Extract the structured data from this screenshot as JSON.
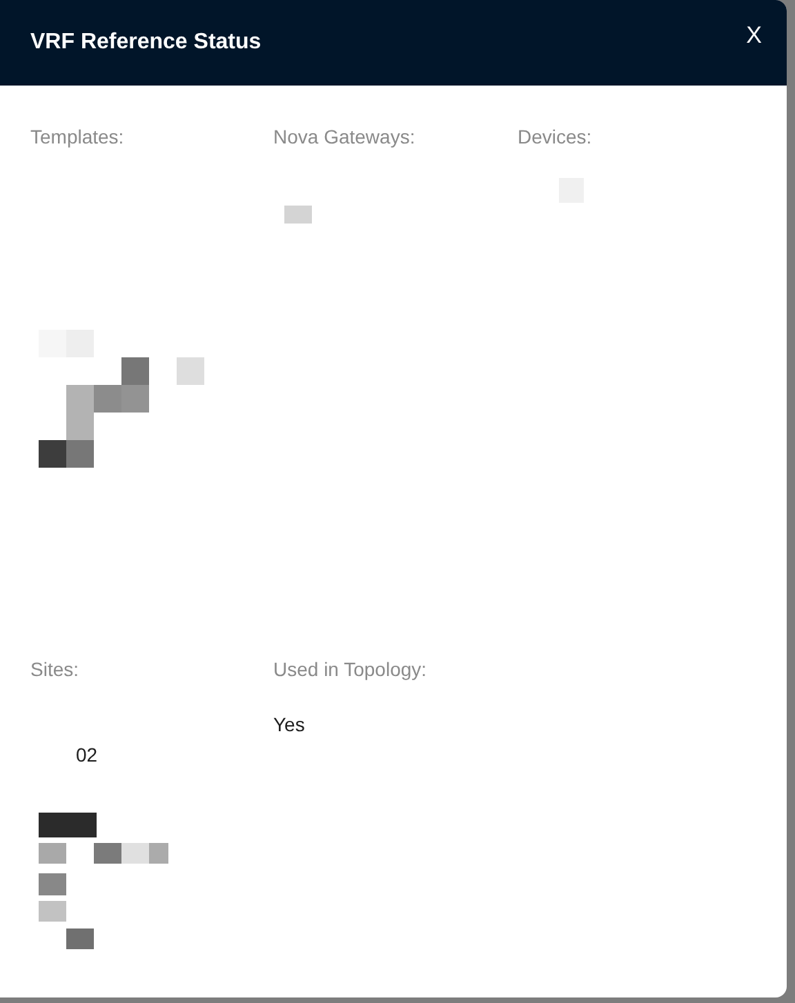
{
  "dialog": {
    "title": "VRF Reference Status",
    "close": "X"
  },
  "fields": [
    {
      "label": "Templates:",
      "kind": "redacted"
    },
    {
      "label": "Nova Gateways:",
      "kind": "redacted"
    },
    {
      "label": "Devices:",
      "kind": "redacted"
    },
    {
      "label": "Sites:",
      "kind": "partial",
      "value": "02"
    },
    {
      "label": "Used in Topology:",
      "kind": "text",
      "value": "Yes"
    }
  ]
}
